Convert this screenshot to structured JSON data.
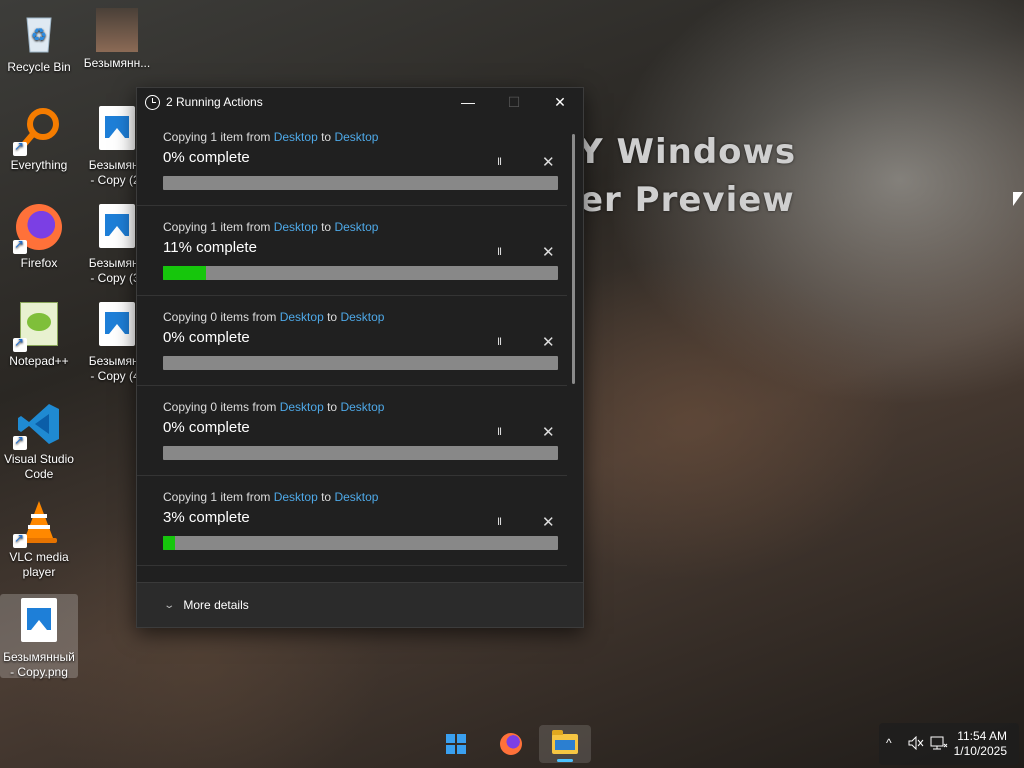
{
  "wallpaper": {
    "text_line1": "Y Windows",
    "text_line2": "er Preview"
  },
  "desktop": {
    "icons": [
      {
        "label": "Recycle Bin",
        "icon": "recycle-bin-icon"
      },
      {
        "label": "Безымянн...",
        "icon": "photo-thumbnail-icon"
      },
      {
        "label": "Everything",
        "icon": "everything-search-icon"
      },
      {
        "label": "Безымянн\n- Copy (2)",
        "icon": "image-file-icon"
      },
      {
        "label": "Firefox",
        "icon": "firefox-icon"
      },
      {
        "label": "Безымянн\n- Copy (3)",
        "icon": "image-file-icon"
      },
      {
        "label": "Notepad++",
        "icon": "notepadpp-icon"
      },
      {
        "label": "Безымянн\n- Copy (4)",
        "icon": "image-file-icon"
      },
      {
        "label": "Visual Studio Code",
        "icon": "vscode-icon"
      },
      {
        "label": "VLC media player",
        "icon": "vlc-icon"
      },
      {
        "label": "Безымянный - Copy.png",
        "icon": "image-file-icon"
      }
    ]
  },
  "dialog": {
    "title": "2 Running Actions",
    "minimize": "—",
    "maximize": "☐",
    "close": "✕",
    "items": [
      {
        "prefix": "Copying 1 item from",
        "from": "Desktop",
        "to_word": "to",
        "to": "Desktop",
        "percent_text": "0% complete",
        "progress": 0
      },
      {
        "prefix": "Copying 1 item from",
        "from": "Desktop",
        "to_word": "to",
        "to": "Desktop",
        "percent_text": "11% complete",
        "progress": 11
      },
      {
        "prefix": "Copying 0 items from",
        "from": "Desktop",
        "to_word": "to",
        "to": "Desktop",
        "percent_text": "0% complete",
        "progress": 0
      },
      {
        "prefix": "Copying 0 items from",
        "from": "Desktop",
        "to_word": "to",
        "to": "Desktop",
        "percent_text": "0% complete",
        "progress": 0
      },
      {
        "prefix": "Copying 1 item from",
        "from": "Desktop",
        "to_word": "to",
        "to": "Desktop",
        "percent_text": "3% complete",
        "progress": 3
      }
    ],
    "pause_glyph": "II",
    "cancel_glyph": "✕",
    "more_details": "More details",
    "chevron": "⌄"
  },
  "taskbar": {
    "tray_up": "^",
    "time": "11:54 AM",
    "date": "1/10/2025"
  },
  "colors": {
    "progress_fill": "#16c60c",
    "link": "#4ea9e8",
    "dialog_bg": "#202020"
  }
}
